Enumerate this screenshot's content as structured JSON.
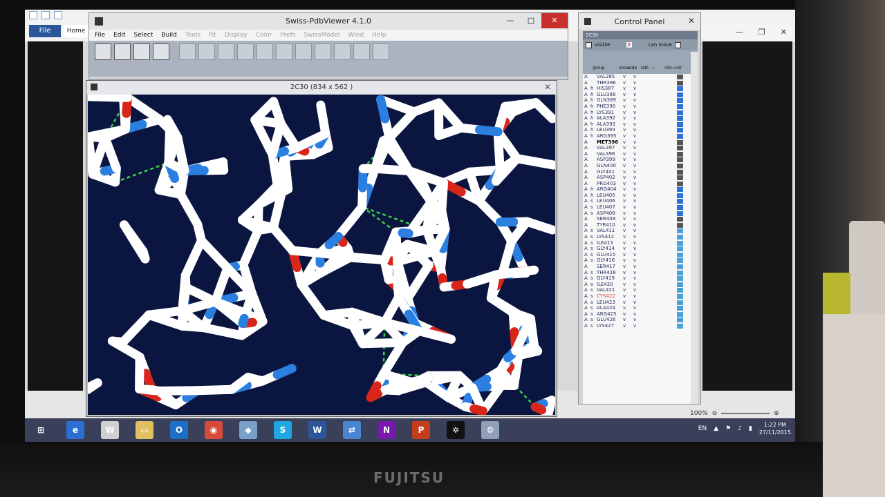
{
  "photo": {
    "brand": "FUJITSU"
  },
  "word": {
    "file_tab": "File",
    "home_tab": "Home",
    "zoom": "100%"
  },
  "spv": {
    "title": "Swiss-PdbViewer 4.1.0",
    "menu": [
      "File",
      "Edit",
      "Select",
      "Build",
      "Tools",
      "Fit",
      "Display",
      "Color",
      "Prefs",
      "SwissModel",
      "Wind",
      "Help"
    ],
    "menu_enabled": [
      true,
      true,
      true,
      true,
      false,
      false,
      false,
      false,
      false,
      false,
      false,
      false
    ],
    "question": "?"
  },
  "view": {
    "title": "2C30  (834 x 562 )",
    "colors": {
      "background": "#0b1640",
      "carbon": "#ffffff",
      "nitrogen": "#2b7fe0",
      "oxygen": "#d8261a",
      "sulfur": "#f2e94a",
      "hbond": "#39d14a"
    }
  },
  "control_panel": {
    "title": "Control Panel",
    "protein": "2C30",
    "visible_label": "visible",
    "warning": "!",
    "can_move_label": "can move",
    "columns": [
      "group",
      "show",
      "side",
      "labl",
      "::",
      "ribn",
      "colr"
    ],
    "rows": [
      {
        "chain": "A",
        "ss": "",
        "res": "VAL385",
        "show": "v",
        "side": "v",
        "color": "#555555"
      },
      {
        "chain": "A",
        "ss": "",
        "res": "THR386",
        "show": "v",
        "side": "v",
        "color": "#555555"
      },
      {
        "chain": "A",
        "ss": "h",
        "res": "HIS387",
        "show": "v",
        "side": "v",
        "color": "#2d72d9"
      },
      {
        "chain": "A",
        "ss": "h",
        "res": "GLU388",
        "show": "v",
        "side": "v",
        "color": "#2d72d9"
      },
      {
        "chain": "A",
        "ss": "h",
        "res": "GLN389",
        "show": "v",
        "side": "v",
        "color": "#2d72d9"
      },
      {
        "chain": "A",
        "ss": "h",
        "res": "PHE390",
        "show": "v",
        "side": "v",
        "color": "#2d72d9"
      },
      {
        "chain": "A",
        "ss": "h",
        "res": "LYS391",
        "show": "v",
        "side": "v",
        "color": "#2d72d9"
      },
      {
        "chain": "A",
        "ss": "h",
        "res": "ALA392",
        "show": "v",
        "side": "v",
        "color": "#2d72d9"
      },
      {
        "chain": "A",
        "ss": "h",
        "res": "ALA393",
        "show": "v",
        "side": "v",
        "color": "#2d72d9"
      },
      {
        "chain": "A",
        "ss": "h",
        "res": "LEU394",
        "show": "v",
        "side": "v",
        "color": "#2d72d9"
      },
      {
        "chain": "A",
        "ss": "h",
        "res": "ARG395",
        "show": "v",
        "side": "v",
        "color": "#2d72d9"
      },
      {
        "chain": "A",
        "ss": "",
        "res": "MET396",
        "show": "v",
        "side": "v",
        "color": "#555555",
        "bold": true
      },
      {
        "chain": "A",
        "ss": "",
        "res": "VAL397",
        "show": "v",
        "side": "v",
        "color": "#555555"
      },
      {
        "chain": "A",
        "ss": "",
        "res": "VAL398",
        "show": "v",
        "side": "v",
        "color": "#555555"
      },
      {
        "chain": "A",
        "ss": "",
        "res": "ASP399",
        "show": "v",
        "side": "v",
        "color": "#555555"
      },
      {
        "chain": "A",
        "ss": "",
        "res": "GLN400",
        "show": "v",
        "side": "v",
        "color": "#555555"
      },
      {
        "chain": "A",
        "ss": "",
        "res": "GLY401",
        "show": "v",
        "side": "v",
        "color": "#555555"
      },
      {
        "chain": "A",
        "ss": "",
        "res": "ASP402",
        "show": "v",
        "side": "v",
        "color": "#555555"
      },
      {
        "chain": "A",
        "ss": "",
        "res": "PRO403",
        "show": "v",
        "side": "v",
        "color": "#555555"
      },
      {
        "chain": "A",
        "ss": "h",
        "res": "ARG404",
        "show": "v",
        "side": "v",
        "color": "#2d72d9"
      },
      {
        "chain": "A",
        "ss": "h",
        "res": "LEU405",
        "show": "v",
        "side": "v",
        "color": "#2d72d9"
      },
      {
        "chain": "A",
        "ss": "s",
        "res": "LEU406",
        "show": "v",
        "side": "v",
        "color": "#2d72d9"
      },
      {
        "chain": "A",
        "ss": "s",
        "res": "LEU407",
        "show": "v",
        "side": "v",
        "color": "#2d72d9"
      },
      {
        "chain": "A",
        "ss": "s",
        "res": "ASP408",
        "show": "v",
        "side": "v",
        "color": "#2d72d9"
      },
      {
        "chain": "A",
        "ss": "",
        "res": "SER409",
        "show": "v",
        "side": "v",
        "color": "#555555"
      },
      {
        "chain": "A",
        "ss": "",
        "res": "TYR410",
        "show": "v",
        "side": "v",
        "color": "#555555"
      },
      {
        "chain": "A",
        "ss": "s",
        "res": "VAL411",
        "show": "v",
        "side": "v",
        "color": "#4aa0d8"
      },
      {
        "chain": "A",
        "ss": "s",
        "res": "LYS412",
        "show": "v",
        "side": "v",
        "color": "#4aa0d8"
      },
      {
        "chain": "A",
        "ss": "s",
        "res": "ILE413",
        "show": "v",
        "side": "v",
        "color": "#4aa0d8"
      },
      {
        "chain": "A",
        "ss": "s",
        "res": "GLY414",
        "show": "v",
        "side": "v",
        "color": "#4aa0d8"
      },
      {
        "chain": "A",
        "ss": "s",
        "res": "GLU415",
        "show": "v",
        "side": "v",
        "color": "#4aa0d8"
      },
      {
        "chain": "A",
        "ss": "s",
        "res": "GLY416",
        "show": "v",
        "side": "v",
        "color": "#4aa0d8"
      },
      {
        "chain": "A",
        "ss": "",
        "res": "SER417",
        "show": "v",
        "side": "v",
        "color": "#4aa0d8"
      },
      {
        "chain": "A",
        "ss": "s",
        "res": "THR418",
        "show": "v",
        "side": "v",
        "color": "#4aa0d8"
      },
      {
        "chain": "A",
        "ss": "s",
        "res": "GLY419",
        "show": "v",
        "side": "v",
        "color": "#4aa0d8"
      },
      {
        "chain": "A",
        "ss": "s",
        "res": "ILE420",
        "show": "v",
        "side": "v",
        "color": "#4aa0d8"
      },
      {
        "chain": "A",
        "ss": "s",
        "res": "VAL421",
        "show": "v",
        "side": "v",
        "color": "#4aa0d8"
      },
      {
        "chain": "A",
        "ss": "s",
        "res": "CYS422",
        "show": "v",
        "side": "v",
        "color": "#4aa0d8",
        "red": true
      },
      {
        "chain": "A",
        "ss": "s",
        "res": "LEU423",
        "show": "v",
        "side": "v",
        "color": "#4aa0d8"
      },
      {
        "chain": "A",
        "ss": "s",
        "res": "ALA424",
        "show": "v",
        "side": "v",
        "color": "#4aa0d8"
      },
      {
        "chain": "A",
        "ss": "s",
        "res": "ARG425",
        "show": "v",
        "side": "v",
        "color": "#4aa0d8"
      },
      {
        "chain": "A",
        "ss": "s",
        "res": "GLU426",
        "show": "v",
        "side": "v",
        "color": "#4aa0d8"
      },
      {
        "chain": "A",
        "ss": "s",
        "res": "LYS427",
        "show": "v",
        "side": "v",
        "color": "#4aa0d8"
      }
    ]
  },
  "taskbar": {
    "apps": [
      {
        "name": "start-button",
        "glyph": "⊞",
        "color": "#3a3f5a"
      },
      {
        "name": "internet-explorer-icon",
        "glyph": "e",
        "color": "#2a6fd1"
      },
      {
        "name": "word-doc-icon",
        "glyph": "W",
        "color": "#d0d0d0"
      },
      {
        "name": "file-explorer-icon",
        "glyph": "▭",
        "color": "#e0c060"
      },
      {
        "name": "outlook-icon",
        "glyph": "O",
        "color": "#1c6fc4"
      },
      {
        "name": "chrome-icon",
        "glyph": "◉",
        "color": "#d94a38"
      },
      {
        "name": "people-icon",
        "glyph": "◆",
        "color": "#7aa0c8"
      },
      {
        "name": "skype-icon",
        "glyph": "S",
        "color": "#1ea7e1"
      },
      {
        "name": "word-icon",
        "glyph": "W",
        "color": "#2b579a"
      },
      {
        "name": "sync-icon",
        "glyph": "⇄",
        "color": "#4a86d0"
      },
      {
        "name": "onenote-icon",
        "glyph": "N",
        "color": "#7719aa"
      },
      {
        "name": "powerpoint-icon",
        "glyph": "P",
        "color": "#c43e1c"
      },
      {
        "name": "pdbviewer-icon",
        "glyph": "✲",
        "color": "#111111"
      },
      {
        "name": "settings-icon",
        "glyph": "⚙",
        "color": "#8fa0b8"
      }
    ],
    "lang": "EN",
    "time": "1:22 PM",
    "date": "27/11/2015"
  }
}
